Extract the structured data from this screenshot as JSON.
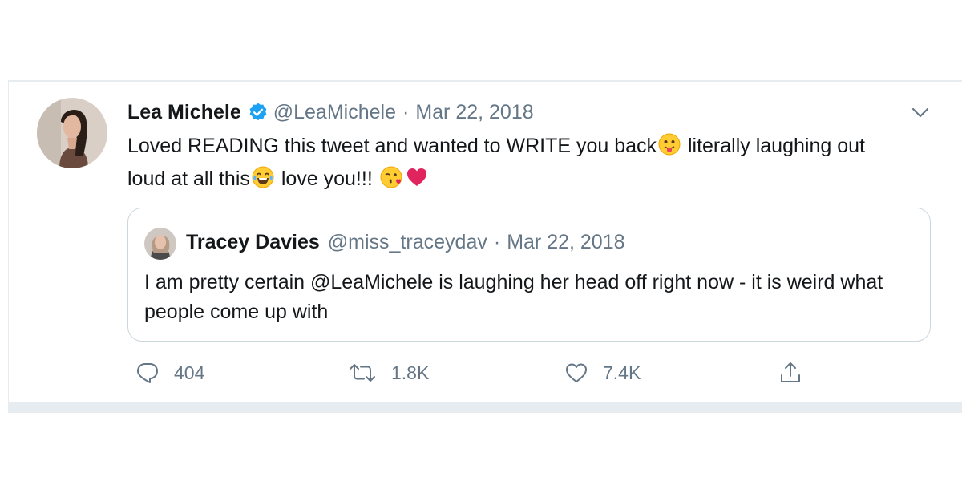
{
  "tweet": {
    "author_name": "Lea Michele",
    "author_handle": "@LeaMichele",
    "separator": "·",
    "date": "Mar 22, 2018",
    "text_part1": "Loved READING this tweet and wanted to WRITE you back",
    "text_part2": " literally laughing out loud at all this",
    "text_part3": " love you!!! ",
    "emojis": [
      "face-with-tongue-emoji",
      "face-with-tears-of-joy-emoji",
      "face-blowing-kiss-emoji",
      "red-heart-emoji"
    ]
  },
  "quoted": {
    "author_name": "Tracey Davies",
    "author_handle": "@miss_traceydav",
    "separator": "·",
    "date": "Mar 22, 2018",
    "text": "I am pretty certain @LeaMichele is laughing her head off right now - it is weird what people come up with"
  },
  "actions": {
    "reply_count": "404",
    "retweet_count": "1.8K",
    "like_count": "7.4K"
  },
  "icons": [
    "verified-badge-icon",
    "chevron-down-icon",
    "reply-icon",
    "retweet-icon",
    "like-icon",
    "share-icon"
  ],
  "colors": {
    "accent": "#1da1f2",
    "text": "#14171a",
    "muted": "#657786",
    "border": "#ccd6dd",
    "heart": "#e0245e"
  }
}
